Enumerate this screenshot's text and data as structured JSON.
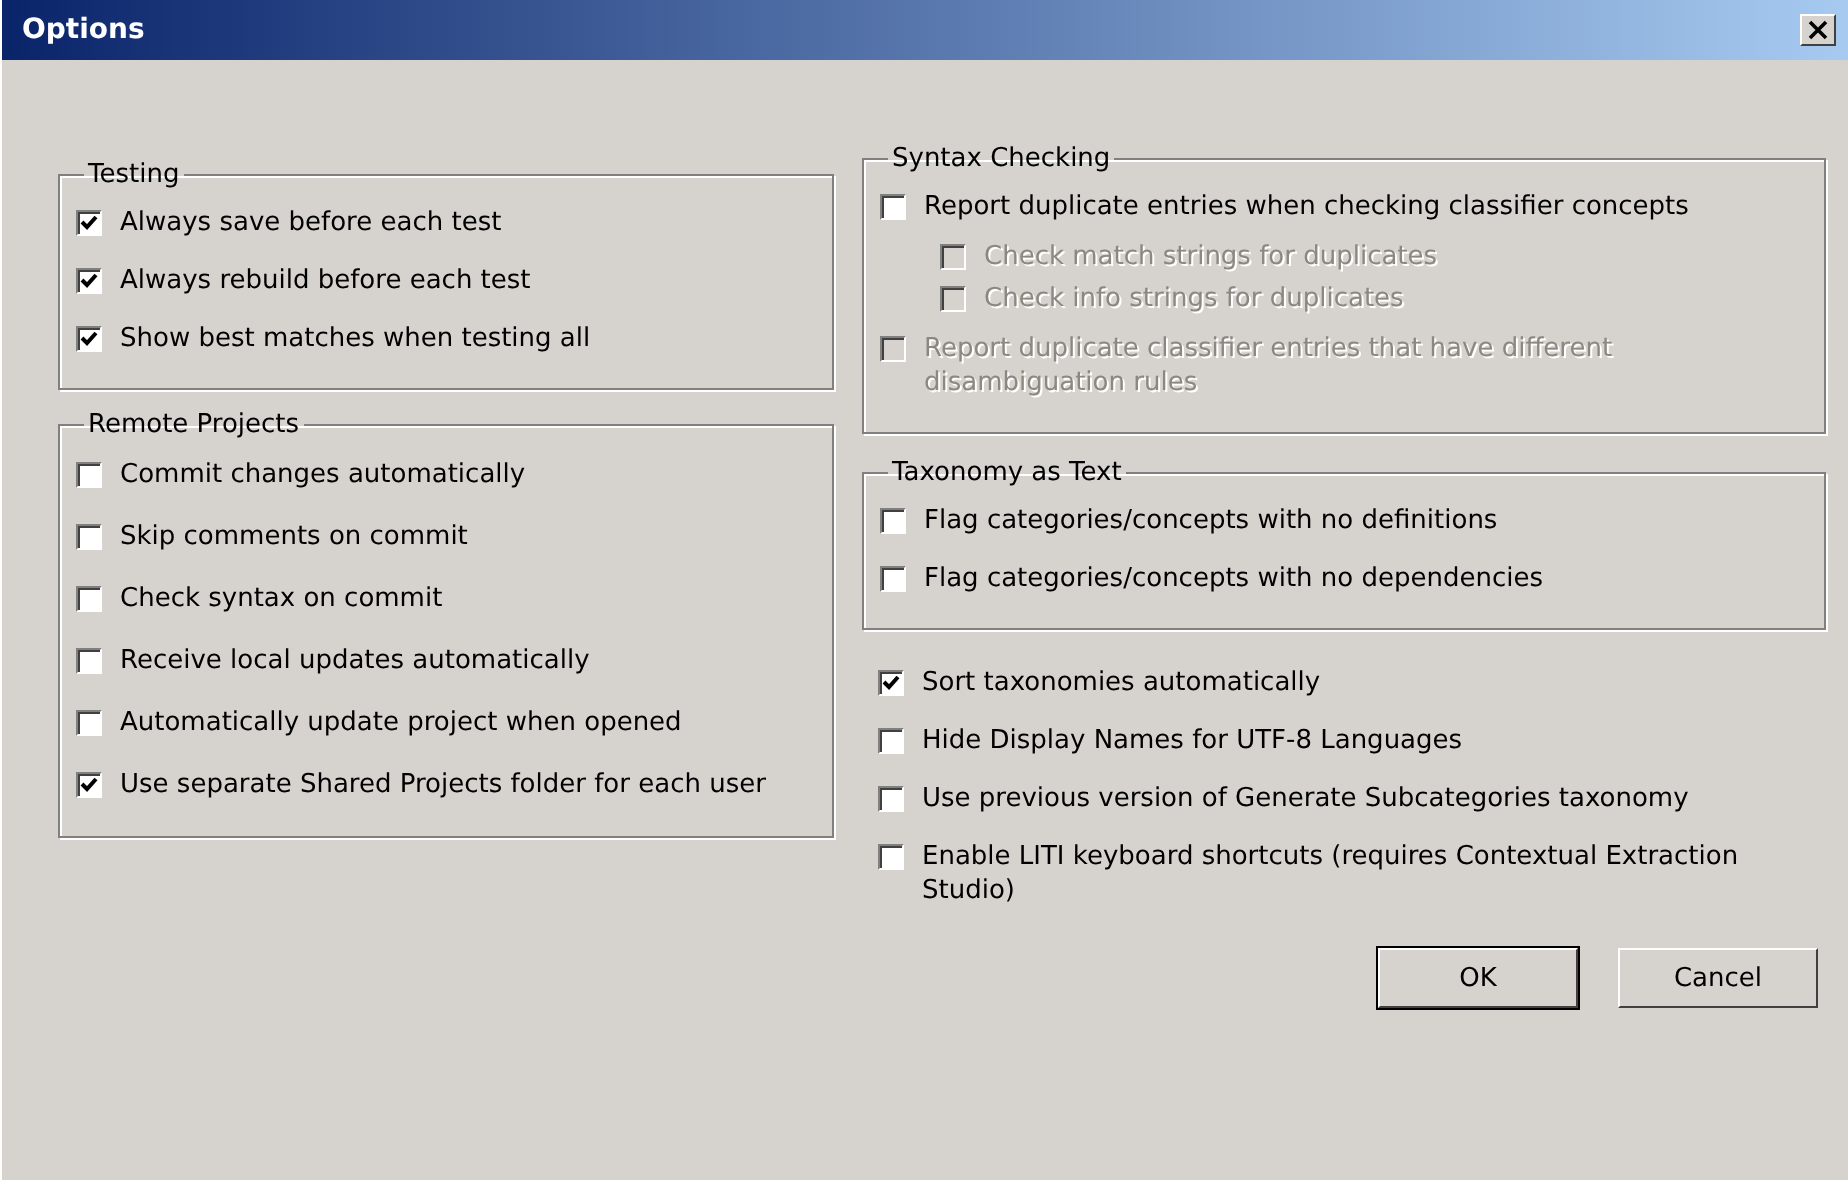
{
  "window": {
    "title": "Options"
  },
  "left_groups": [
    {
      "title": "Testing",
      "options": [
        {
          "label": "Always save before each test",
          "checked": true
        },
        {
          "label": "Always rebuild before each test",
          "checked": true
        },
        {
          "label": "Show best matches when testing all",
          "checked": true
        }
      ]
    },
    {
      "title": "Remote Projects",
      "options": [
        {
          "label": "Commit changes automatically",
          "checked": false
        },
        {
          "label": "Skip comments on commit",
          "checked": false
        },
        {
          "label": "Check syntax on commit",
          "checked": false
        },
        {
          "label": "Receive local updates automatically",
          "checked": false
        },
        {
          "label": "Automatically update project when opened",
          "checked": false
        },
        {
          "label": "Use separate Shared Projects folder for each user",
          "checked": true
        }
      ]
    }
  ],
  "right_groups": [
    {
      "title": "Syntax Checking",
      "options": [
        {
          "label": "Report duplicate entries when checking classifier concepts",
          "checked": false,
          "disabled": false,
          "children": [
            {
              "label": "Check match strings for duplicates",
              "checked": false,
              "disabled": true
            },
            {
              "label": "Check info strings for duplicates",
              "checked": false,
              "disabled": true
            }
          ]
        },
        {
          "label": "Report duplicate classifier entries that have different disambiguation rules",
          "checked": false,
          "disabled": true
        }
      ]
    },
    {
      "title": "Taxonomy as Text",
      "options": [
        {
          "label": "Flag categories/concepts with no definitions",
          "checked": false,
          "disabled": false
        },
        {
          "label": "Flag categories/concepts with no dependencies",
          "checked": false,
          "disabled": false
        }
      ]
    }
  ],
  "options": [
    {
      "label": "Sort taxonomies automatically",
      "checked": true
    },
    {
      "label": "Hide Display Names for UTF-8 Languages",
      "checked": false
    },
    {
      "label": "Use previous version of Generate Subcategories taxonomy",
      "checked": false
    },
    {
      "label": "Enable LITI keyboard shortcuts (requires Contextual Extraction Studio)",
      "checked": false
    }
  ],
  "buttons": [
    {
      "label": "OK",
      "default": true
    },
    {
      "label": "Cancel",
      "default": false
    }
  ]
}
